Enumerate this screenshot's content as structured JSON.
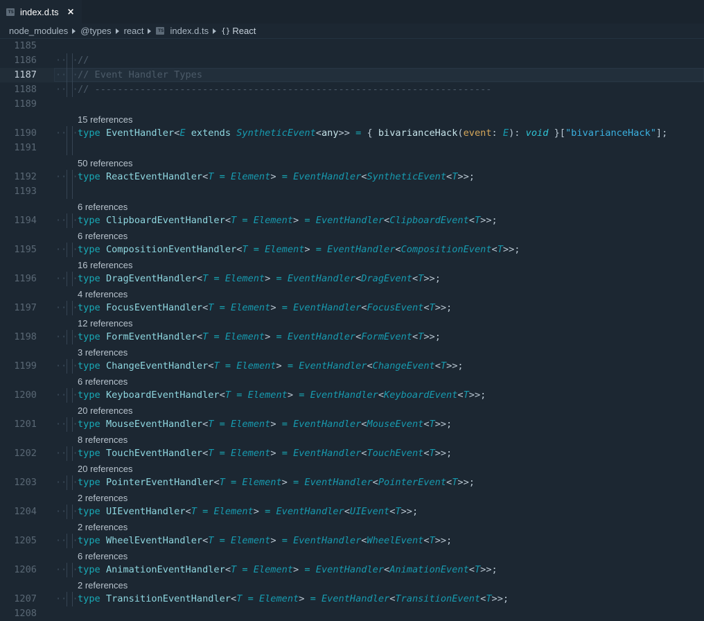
{
  "tab": {
    "icon": "typescript-file-icon",
    "icon_text": "TS",
    "label": "index.d.ts",
    "close_icon": "×"
  },
  "breadcrumb": [
    {
      "label": "node_modules"
    },
    {
      "label": "@types"
    },
    {
      "label": "react"
    },
    {
      "label": "index.d.ts",
      "icon_text": "TS"
    },
    {
      "label": "React",
      "icon_text": "{}"
    }
  ],
  "lines": {
    "l1185": {
      "num": "1185"
    },
    "l1186": {
      "num": "1186",
      "text": "//"
    },
    "l1187": {
      "num": "1187",
      "text": "// Event Handler Types"
    },
    "l1188": {
      "num": "1188",
      "text": "// ----------------------------------------------------------------------"
    },
    "l1189": {
      "num": "1189"
    },
    "l1190": {
      "num": "1190",
      "lens": "15 references",
      "kw": "type",
      "name": "EventHandler",
      "tparam": "E",
      "extends": "extends",
      "base": "SyntheticEvent",
      "any": "any",
      "hack": "bivarianceHack",
      "param": "event",
      "void": "void",
      "str": "\"bivarianceHack\""
    },
    "l1191": {
      "num": "1191"
    },
    "l1192": {
      "num": "1192",
      "lens": "50 references",
      "kw": "type",
      "name": "ReactEventHandler",
      "tparam": "T",
      "def": "Element",
      "handler": "EventHandler",
      "event": "SyntheticEvent"
    },
    "l1193": {
      "num": "1193"
    },
    "l1194": {
      "num": "1194",
      "lens": "6 references",
      "kw": "type",
      "name": "ClipboardEventHandler",
      "tparam": "T",
      "def": "Element",
      "handler": "EventHandler",
      "event": "ClipboardEvent"
    },
    "l1195": {
      "num": "1195",
      "lens": "6 references",
      "kw": "type",
      "name": "CompositionEventHandler",
      "tparam": "T",
      "def": "Element",
      "handler": "EventHandler",
      "event": "CompositionEvent"
    },
    "l1196": {
      "num": "1196",
      "lens": "16 references",
      "kw": "type",
      "name": "DragEventHandler",
      "tparam": "T",
      "def": "Element",
      "handler": "EventHandler",
      "event": "DragEvent"
    },
    "l1197": {
      "num": "1197",
      "lens": "4 references",
      "kw": "type",
      "name": "FocusEventHandler",
      "tparam": "T",
      "def": "Element",
      "handler": "EventHandler",
      "event": "FocusEvent"
    },
    "l1198": {
      "num": "1198",
      "lens": "12 references",
      "kw": "type",
      "name": "FormEventHandler",
      "tparam": "T",
      "def": "Element",
      "handler": "EventHandler",
      "event": "FormEvent"
    },
    "l1199": {
      "num": "1199",
      "lens": "3 references",
      "kw": "type",
      "name": "ChangeEventHandler",
      "tparam": "T",
      "def": "Element",
      "handler": "EventHandler",
      "event": "ChangeEvent"
    },
    "l1200": {
      "num": "1200",
      "lens": "6 references",
      "kw": "type",
      "name": "KeyboardEventHandler",
      "tparam": "T",
      "def": "Element",
      "handler": "EventHandler",
      "event": "KeyboardEvent"
    },
    "l1201": {
      "num": "1201",
      "lens": "20 references",
      "kw": "type",
      "name": "MouseEventHandler",
      "tparam": "T",
      "def": "Element",
      "handler": "EventHandler",
      "event": "MouseEvent"
    },
    "l1202": {
      "num": "1202",
      "lens": "8 references",
      "kw": "type",
      "name": "TouchEventHandler",
      "tparam": "T",
      "def": "Element",
      "handler": "EventHandler",
      "event": "TouchEvent"
    },
    "l1203": {
      "num": "1203",
      "lens": "20 references",
      "kw": "type",
      "name": "PointerEventHandler",
      "tparam": "T",
      "def": "Element",
      "handler": "EventHandler",
      "event": "PointerEvent"
    },
    "l1204": {
      "num": "1204",
      "lens": "2 references",
      "kw": "type",
      "name": "UIEventHandler",
      "tparam": "T",
      "def": "Element",
      "handler": "EventHandler",
      "event": "UIEvent"
    },
    "l1205": {
      "num": "1205",
      "lens": "2 references",
      "kw": "type",
      "name": "WheelEventHandler",
      "tparam": "T",
      "def": "Element",
      "handler": "EventHandler",
      "event": "WheelEvent"
    },
    "l1206": {
      "num": "1206",
      "lens": "6 references",
      "kw": "type",
      "name": "AnimationEventHandler",
      "tparam": "T",
      "def": "Element",
      "handler": "EventHandler",
      "event": "AnimationEvent"
    },
    "l1207": {
      "num": "1207",
      "lens": "2 references",
      "kw": "type",
      "name": "TransitionEventHandler",
      "tparam": "T",
      "def": "Element",
      "handler": "EventHandler",
      "event": "TransitionEvent"
    },
    "l1208": {
      "num": "1208"
    }
  },
  "colors": {
    "background": "#1c2732",
    "keyword": "#18aab7",
    "type_name": "#8fd7e0",
    "comment": "#4c5b69",
    "string": "#3bb1e0",
    "parameter": "#d6a85a"
  }
}
